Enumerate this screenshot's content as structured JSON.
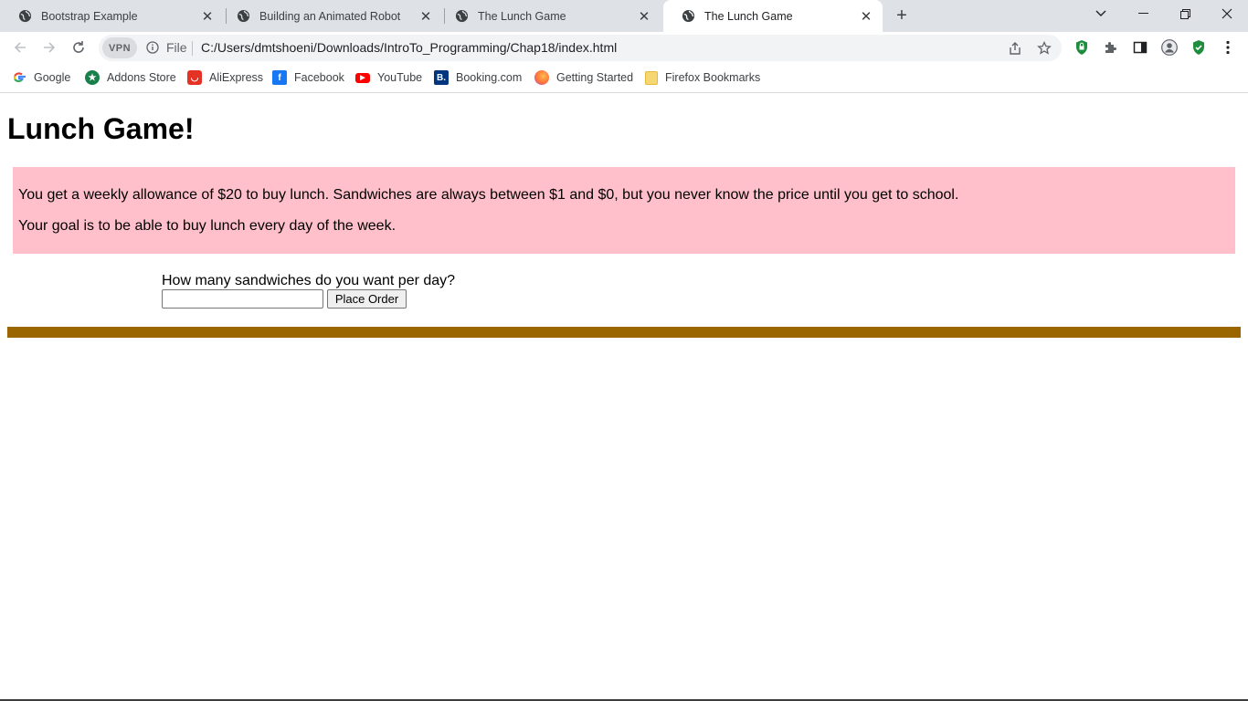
{
  "tabs": [
    {
      "title": "Bootstrap Example",
      "active": false
    },
    {
      "title": "Building an Animated Robot",
      "active": false
    },
    {
      "title": "The Lunch Game",
      "active": false
    },
    {
      "title": "The Lunch Game",
      "active": true
    }
  ],
  "toolbar": {
    "vpn_label": "VPN",
    "scheme": "File",
    "url": "C:/Users/dmtshoeni/Downloads/IntroTo_Programming/Chap18/index.html"
  },
  "bookmarks": [
    {
      "label": "Google",
      "icon": "google-icon",
      "color": "#4285f4"
    },
    {
      "label": "Addons Store",
      "icon": "addons-store-icon",
      "color": "#1a7f4b"
    },
    {
      "label": "AliExpress",
      "icon": "aliexpress-icon",
      "color": "#e43225"
    },
    {
      "label": "Facebook",
      "icon": "facebook-icon",
      "color": "#1877f2"
    },
    {
      "label": "YouTube",
      "icon": "youtube-icon",
      "color": "#ff0000"
    },
    {
      "label": "Booking.com",
      "icon": "booking-icon",
      "color": "#003580"
    },
    {
      "label": "Getting Started",
      "icon": "firefox-icon",
      "color": "#ff7139"
    },
    {
      "label": "Firefox Bookmarks",
      "icon": "folder-icon",
      "color": "#f7d774"
    }
  ],
  "page": {
    "heading": "Lunch Game!",
    "intro_line1": "You get a weekly allowance of $20 to buy lunch. Sandwiches are always between $1 and $0, but you never know the price until you get to school.",
    "intro_line2": "Your goal is to be able to buy lunch every day of the week.",
    "question": "How many sandwiches do you want per day?",
    "input_value": "",
    "button_label": "Place Order",
    "intro_bg": "#ffc0cb",
    "bar_color": "#996600"
  }
}
